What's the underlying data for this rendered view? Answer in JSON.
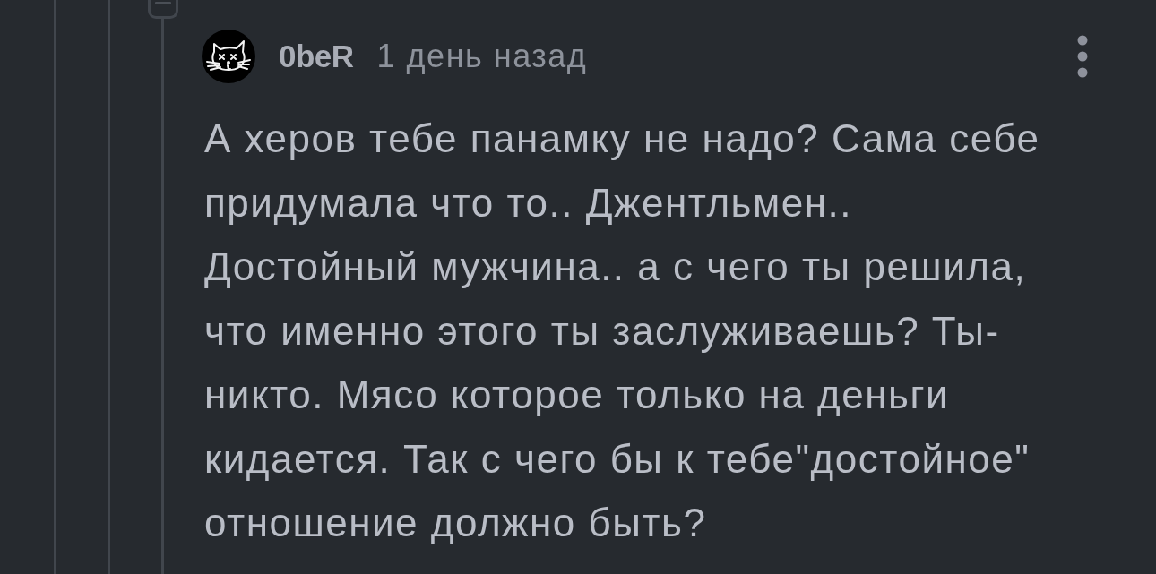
{
  "thread": {
    "collapse_button": {
      "expanded": true
    }
  },
  "comment": {
    "author": "0beR",
    "time": "1 день назад",
    "text": "А херов тебе панамку не надо? Сама себе придумала что то.. Джентльмен.. Достойный мужчина.. а с чего ты решила, что именно этого ты заслуживаешь? Ты-никто. Мясо которое только на деньги кидается. Так с чего бы к тебе\"достойное\" отношение должно быть?"
  }
}
